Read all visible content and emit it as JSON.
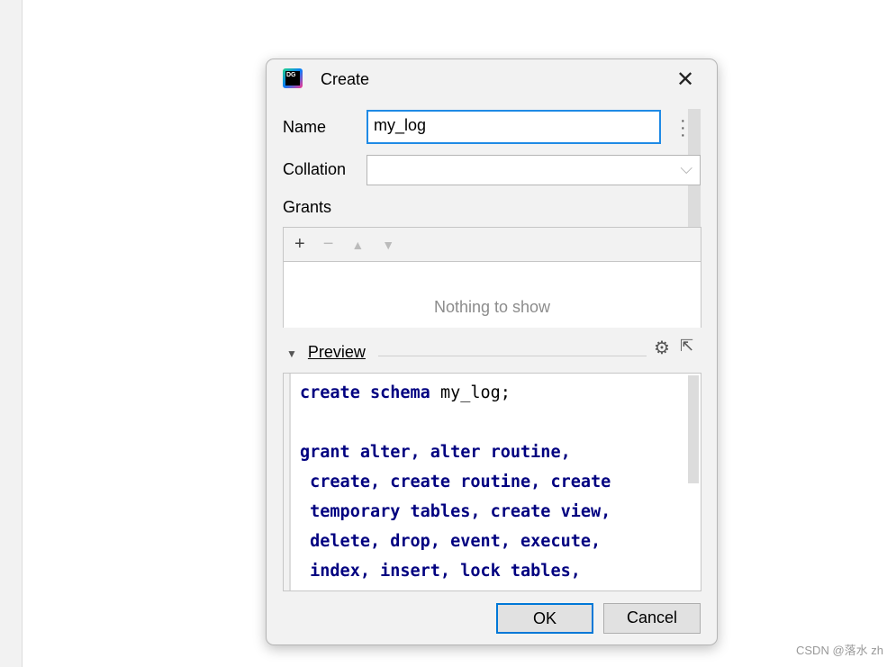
{
  "dialog": {
    "title": "Create",
    "logo_text": "DG",
    "name_label": "Name",
    "name_value": "my_log",
    "collation_label": "Collation",
    "collation_value": "",
    "grants_label": "Grants",
    "grants_empty": "Nothing to show",
    "grants_tools": [
      "+",
      "−",
      "▲",
      "▼"
    ],
    "preview_label": "Preview",
    "preview_lines": [
      "create schema my_log;",
      "",
      "grant alter, alter routine,",
      " create, create routine, create",
      " temporary tables, create view,",
      " delete, drop, event, execute,",
      " index, insert, lock tables,"
    ],
    "ok": "OK",
    "cancel": "Cancel"
  },
  "watermark": "CSDN @落水 zh",
  "colors": {
    "accent": "#0078d7",
    "keyword": "#000080"
  }
}
